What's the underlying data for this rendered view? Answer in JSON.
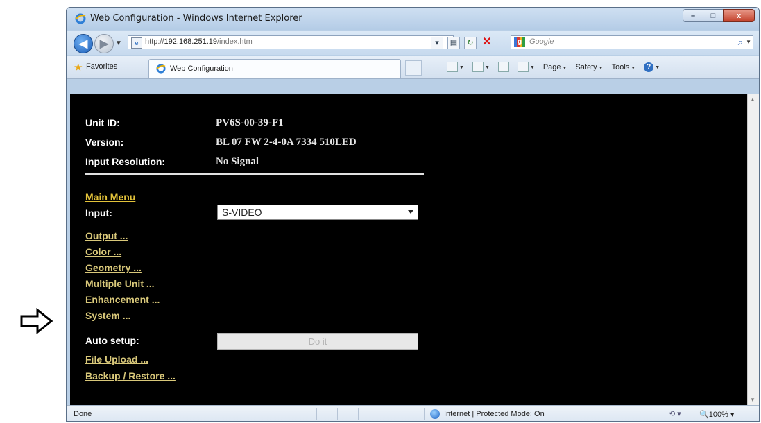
{
  "window": {
    "title": "Web Configuration - Windows Internet Explorer",
    "minimize": "–",
    "maximize": "□",
    "close": "x"
  },
  "address": {
    "url_prefix": "http://",
    "url_host": "192.168.251.19",
    "url_path": "/index.htm",
    "search_placeholder": "Google"
  },
  "favorites": {
    "label": "Favorites",
    "tab_label": "Web Configuration",
    "commands": [
      "Page",
      "Safety",
      "Tools"
    ]
  },
  "info": {
    "unit_id_label": "Unit ID:",
    "unit_id_value": "PV6S-00-39-F1",
    "version_label": "Version:",
    "version_value": "BL 07 FW 2-4-0A 7334 510LED",
    "resolution_label": "Input Resolution:",
    "resolution_value": "No Signal"
  },
  "menu": {
    "main_menu": "Main Menu",
    "input_label": "Input:",
    "input_value": "S-VIDEO",
    "output": "Output ...",
    "color": "Color ...",
    "geometry": "Geometry ...",
    "multiple_unit": "Multiple Unit ...",
    "enhancement": "Enhancement ...",
    "system": "System ...",
    "auto_setup_label": "Auto setup:",
    "do_it": "Do it",
    "file_upload": "File Upload ...",
    "backup_restore": "Backup / Restore ..."
  },
  "status": {
    "done": "Done",
    "zone": "Internet | Protected Mode: On",
    "zoom": "100%"
  },
  "colors": {
    "link": "#d9c87a",
    "main_menu": "#e2c23a",
    "content_bg": "#000000"
  }
}
